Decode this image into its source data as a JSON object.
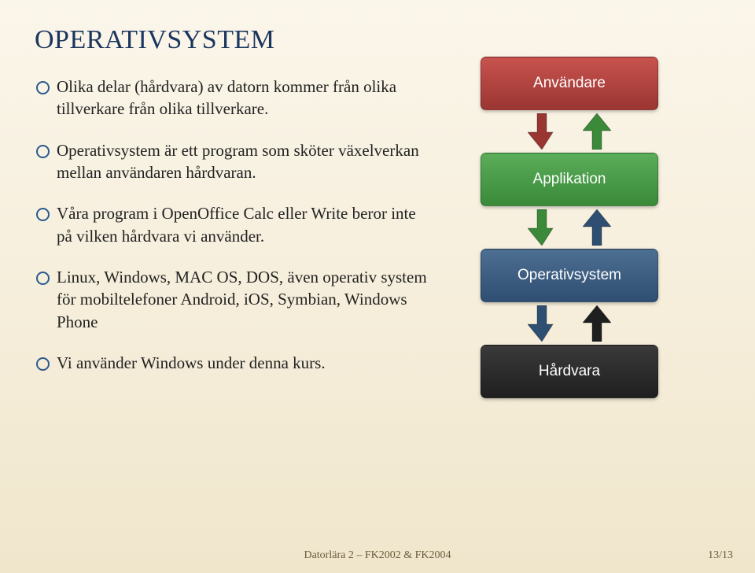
{
  "title": "OPERATIVSYSTEM",
  "bullets": [
    "Olika delar (hårdvara) av datorn kommer från olika tillverkare från olika tillverkare.",
    "Operativsystem är ett program som sköter växelverkan mellan användaren hårdvaran.",
    "Våra program i OpenOffice Calc eller Write beror inte på vilken hårdvara vi använder.",
    "Linux, Windows, MAC OS, DOS, även operativ system för mobiltelefoner Android, iOS, Symbian, Windows Phone",
    "Vi använder Windows under denna kurs."
  ],
  "diagram": {
    "user": "Användare",
    "app": "Applikation",
    "os": "Operativsystem",
    "hw": "Hårdvara",
    "arrow_pairs": [
      {
        "down": "#9a3632",
        "up": "#3a8a39"
      },
      {
        "down": "#3a8a39",
        "up": "#2e4e72"
      },
      {
        "down": "#2e4e72",
        "up": "#1f1f1f"
      }
    ]
  },
  "footer": "Datorlära 2 – FK2002 & FK2004",
  "page": "13/13"
}
